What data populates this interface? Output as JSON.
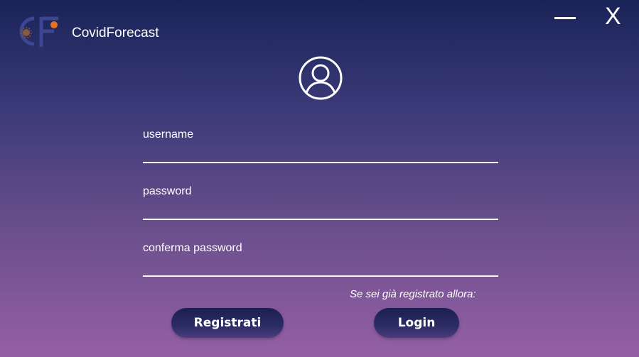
{
  "app": {
    "title": "CovidForecast",
    "logo_text": "CF"
  },
  "window": {
    "minimize_icon": "minimize-icon",
    "close_label": "X"
  },
  "form": {
    "avatar_icon": "user-avatar-icon",
    "username_label": "username",
    "username_value": "",
    "password_label": "password",
    "password_value": "",
    "confirm_label": "conferma password",
    "confirm_value": ""
  },
  "footer": {
    "hint": "Se sei già registrato allora:",
    "register_label": "Registrati",
    "login_label": "Login"
  },
  "colors": {
    "bg_top": "#1a2358",
    "bg_bottom": "#955fa6",
    "button_bg": "#1c1f52",
    "logo_accent": "#e8731e"
  }
}
